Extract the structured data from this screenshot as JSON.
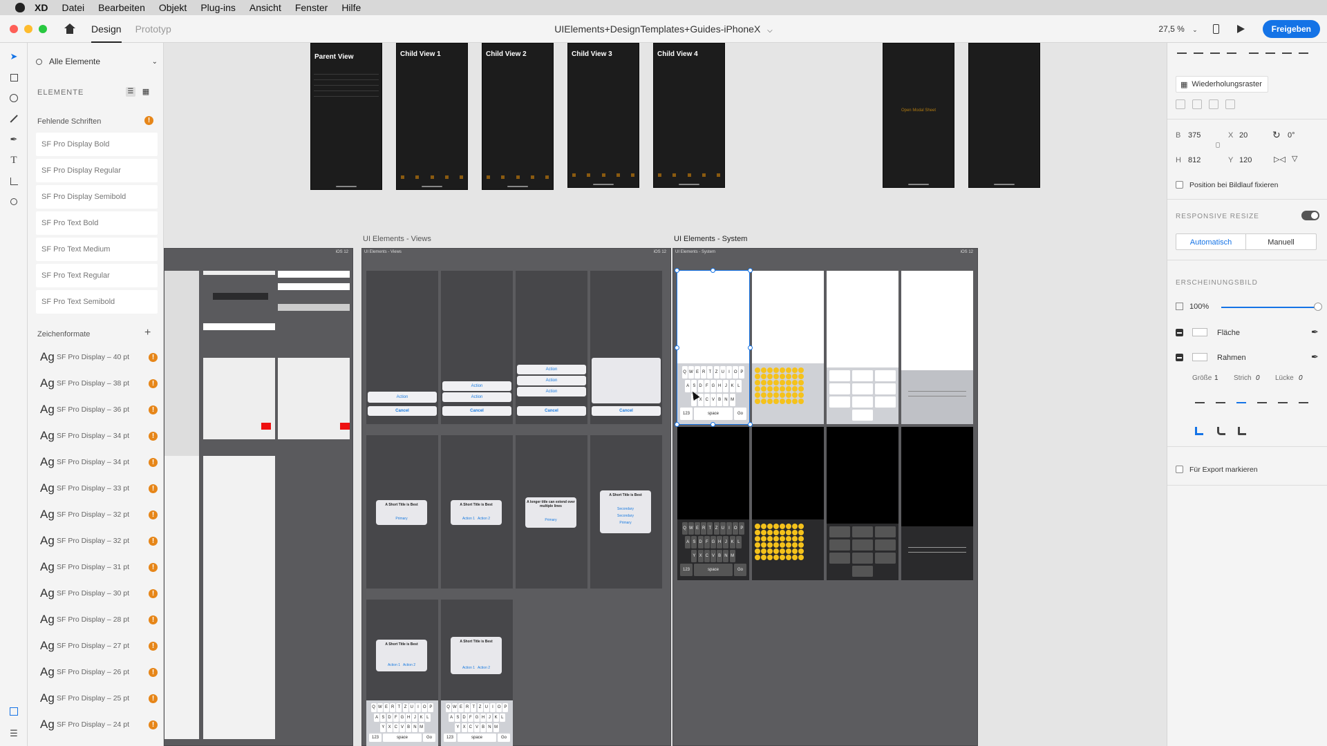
{
  "menubar": {
    "items": [
      "XD",
      "Datei",
      "Bearbeiten",
      "Objekt",
      "Plug-ins",
      "Ansicht",
      "Fenster",
      "Hilfe"
    ]
  },
  "toolbar": {
    "tabs": [
      "Design",
      "Prototyp"
    ],
    "document_title": "UIElements+DesignTemplates+Guides-iPhoneX",
    "zoom": "27,5 %",
    "share_label": "Freigeben"
  },
  "assets": {
    "filter_label": "Alle Elemente",
    "section_title": "ELEMENTE",
    "missing_fonts_label": "Fehlende Schriften",
    "missing_fonts": [
      "SF Pro Display Bold",
      "SF Pro Display Regular",
      "SF Pro Display Semibold",
      "SF Pro Text Bold",
      "SF Pro Text Medium",
      "SF Pro Text Regular",
      "SF Pro Text Semibold"
    ],
    "char_styles_label": "Zeichenformate",
    "char_styles": [
      "SF Pro Display – 40 pt",
      "SF Pro Display – 38 pt",
      "SF Pro Display – 36 pt",
      "SF Pro Display – 34 pt",
      "SF Pro Display – 34 pt",
      "SF Pro Display – 33 pt",
      "SF Pro Display – 32 pt",
      "SF Pro Display – 32 pt",
      "SF Pro Display – 31 pt",
      "SF Pro Display – 30 pt",
      "SF Pro Display – 28 pt",
      "SF Pro Display – 27 pt",
      "SF Pro Display – 26 pt",
      "SF Pro Display – 25 pt",
      "SF Pro Display – 24 pt"
    ],
    "ag_glyph": "Ag"
  },
  "canvas": {
    "top_phones": [
      "Parent View",
      "Child View 1",
      "Child View 2",
      "Child View 3",
      "Child View 4"
    ],
    "modal_hint": "Open Modal Sheet",
    "board_views": "UI Elements - Views",
    "board_system": "UI Elements - System",
    "ios_badge": "iOS 12",
    "sheet_action": "Action",
    "sheet_cancel": "Cancel",
    "alert_title": "A Short Title is Best",
    "alert_long_title": "A longer title can extend over multiple lines",
    "alert_primary": "Primary",
    "alert_action1": "Action 1",
    "alert_action2": "Action 2",
    "alert_secondary": "Secondary",
    "kb_row1": [
      "Q",
      "W",
      "E",
      "R",
      "T",
      "Z",
      "U",
      "I",
      "O",
      "P"
    ],
    "kb_row2": [
      "A",
      "S",
      "D",
      "F",
      "G",
      "H",
      "J",
      "K",
      "L"
    ],
    "kb_row3": [
      "Y",
      "X",
      "C",
      "V",
      "B",
      "N",
      "M"
    ],
    "kb_space": "space",
    "kb_go": "Go",
    "kb_123": "123"
  },
  "inspector": {
    "repeat_grid": "Wiederholungsraster",
    "w_label": "B",
    "w_value": "375",
    "h_label": "H",
    "h_value": "812",
    "x_label": "X",
    "x_value": "20",
    "y_label": "Y",
    "y_value": "120",
    "rotation": "0°",
    "fix_position": "Position bei Bildlauf fixieren",
    "responsive_resize": "RESPONSIVE RESIZE",
    "auto": "Automatisch",
    "manual": "Manuell",
    "appearance": "ERSCHEINUNGSBILD",
    "opacity": "100%",
    "fill": "Fläche",
    "border": "Rahmen",
    "size_label": "Größe",
    "size_value": "1",
    "stroke_label": "Strich",
    "stroke_value": "0",
    "gap_label": "Lücke",
    "gap_value": "0",
    "export_label": "Für Export markieren"
  },
  "colors": {
    "accent": "#1473e6",
    "warning": "#e68619"
  }
}
